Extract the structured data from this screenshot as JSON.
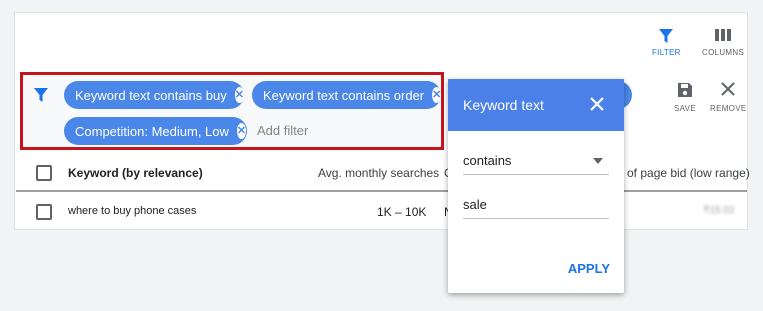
{
  "toolbar": {
    "filter_label": "FILTER",
    "columns_label": "COLUMNS",
    "save_label": "SAVE",
    "remove_label": "REMOVE"
  },
  "filters": {
    "chips": [
      {
        "label": "Keyword text contains buy"
      },
      {
        "label": "Keyword text contains order"
      },
      {
        "label": "Competition: Medium, Low"
      }
    ],
    "add_filter_placeholder": "Add filter"
  },
  "table": {
    "headers": {
      "keyword": "Keyword (by relevance)",
      "avg_searches": "Avg. monthly searches",
      "competition_partial": "C",
      "top_bid_low": "of page bid (low range)"
    },
    "rows": [
      {
        "keyword": "where to buy phone cases",
        "avg_searches": "1K – 10K",
        "competition_partial": "N",
        "bid_low": "₹15.02"
      }
    ]
  },
  "popup": {
    "title": "Keyword text",
    "operator": "contains",
    "value": "sale",
    "apply_label": "APPLY"
  },
  "colors": {
    "accent": "#1a73e8",
    "chip": "#4a87e8",
    "highlight": "#c3151c",
    "popup_header": "#4a80e8"
  }
}
